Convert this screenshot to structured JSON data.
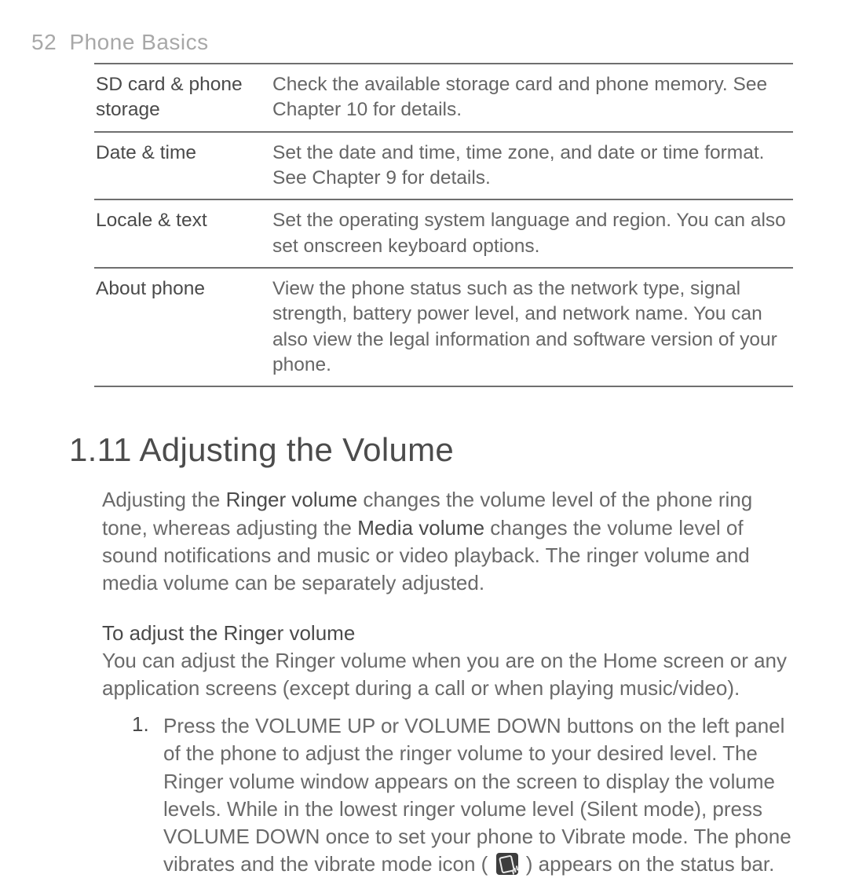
{
  "header": {
    "page_number": "52",
    "section_name": "Phone Basics"
  },
  "settings_table": [
    {
      "name": "SD card & phone storage",
      "desc": "Check the available storage card and phone memory. See Chapter 10 for details."
    },
    {
      "name": "Date & time",
      "desc": "Set the date and time, time zone, and date or time format. See Chapter 9 for details."
    },
    {
      "name": "Locale & text",
      "desc": "Set the operating system language and region. You can also set onscreen keyboard options."
    },
    {
      "name": "About phone",
      "desc": "View the phone status such as the network type, signal strength, battery power level, and network name. You can also view the legal information and software version of your phone."
    }
  ],
  "section": {
    "heading": "1.11  Adjusting the Volume",
    "intro_pre": "Adjusting the ",
    "intro_bold1": "Ringer volume",
    "intro_mid": " changes the volume level of the phone ring tone, whereas adjusting the ",
    "intro_bold2": "Media volume",
    "intro_post": " changes the volume level of sound notifications and music or video playback. The ringer volume and media volume can be separately adjusted."
  },
  "sub": {
    "heading": "To adjust the Ringer volume",
    "para": "You can adjust the Ringer volume when you are on the Home screen or any application screens (except during a call or when playing music/video)."
  },
  "step": {
    "num": "1.",
    "text_pre": "Press the VOLUME UP or VOLUME DOWN buttons on the left panel of the phone to adjust the ringer volume to your desired level. The Ringer volume window appears on the screen to display the volume levels. While in the lowest ringer volume level (Silent mode), press VOLUME DOWN once to set your phone to Vibrate mode. The phone vibrates and the vibrate mode icon ( ",
    "text_post": " ) appears on the status bar.",
    "icon_name": "vibrate-mode"
  }
}
